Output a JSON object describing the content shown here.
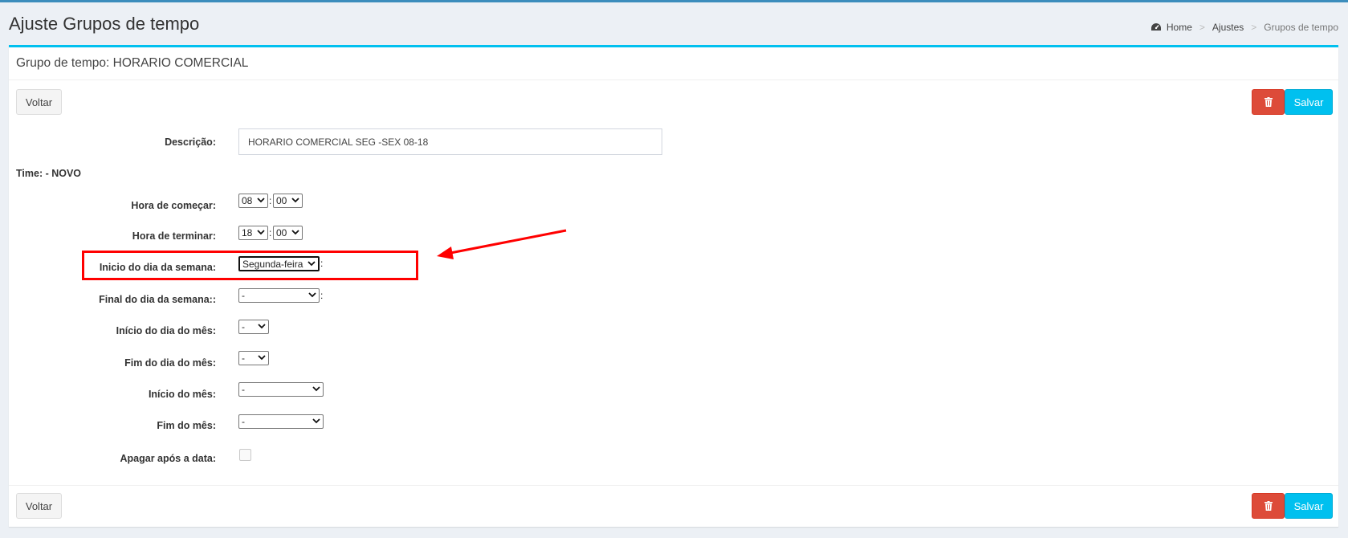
{
  "page": {
    "title": "Ajuste Grupos de tempo"
  },
  "breadcrumb": {
    "home": "Home",
    "settings": "Ajustes",
    "current": "Grupos de tempo",
    "separator": ">"
  },
  "box": {
    "title": "Grupo de tempo: HORARIO COMERCIAL"
  },
  "buttons": {
    "back": "Voltar",
    "save": "Salvar",
    "delete_icon": "trash-icon"
  },
  "form": {
    "description_label": "Descrição:",
    "description_value": "HORARIO COMERCIAL SEG -SEX 08-18",
    "time_heading": "Time: - NOVO",
    "start_time_label": "Hora de começar:",
    "start_hour": "08",
    "start_minute": "00",
    "end_time_label": "Hora de terminar:",
    "end_hour": "18",
    "end_minute": "00",
    "weekday_start_label": "Inicio do dia da semana:",
    "weekday_start_value": "Segunda-feira",
    "weekday_end_label": "Final do dia da semana::",
    "weekday_end_value": "-",
    "monthday_start_label": "Início do dia do mês:",
    "monthday_start_value": "-",
    "monthday_end_label": "Fim do dia do mês:",
    "monthday_end_value": "-",
    "month_start_label": "Início do mês:",
    "month_start_value": "-",
    "month_end_label": "Fim do mês:",
    "month_end_value": "-",
    "delete_after_label": "Apagar após a data:",
    "delete_after_checked": false,
    "colon": ":"
  },
  "annotation": {
    "highlight_color": "#ff0000"
  },
  "colors": {
    "primary": "#3c8dbc",
    "info": "#00c0ef",
    "danger": "#dd4b39",
    "background": "#ecf0f5"
  }
}
